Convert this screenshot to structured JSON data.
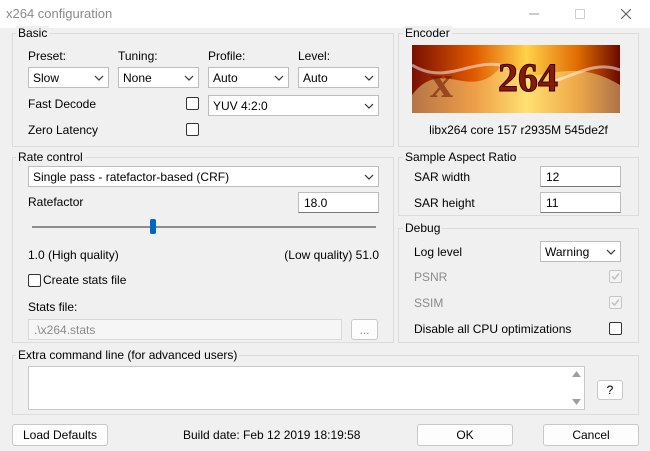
{
  "window": {
    "title": "x264 configuration"
  },
  "basic": {
    "legend": "Basic",
    "preset_label": "Preset:",
    "preset_value": "Slow",
    "tuning_label": "Tuning:",
    "tuning_value": "None",
    "profile_label": "Profile:",
    "profile_value": "Auto",
    "level_label": "Level:",
    "level_value": "Auto",
    "fast_decode_label": "Fast Decode",
    "zero_latency_label": "Zero Latency",
    "colorspace_value": "YUV 4:2:0"
  },
  "encoder": {
    "legend": "Encoder",
    "logo_text": "264",
    "version": "libx264 core 157 r2935M 545de2f"
  },
  "rate": {
    "legend": "Rate control",
    "mode_value": "Single pass - ratefactor-based (CRF)",
    "ratefactor_label": "Ratefactor",
    "ratefactor_value": "18.0",
    "slider_fraction": 0.35,
    "min_label": "1.0 (High quality)",
    "max_label": "(Low quality) 51.0",
    "create_stats_label": "Create stats file",
    "stats_file_label": "Stats file:",
    "stats_file_value": ".\\x264.stats",
    "browse_label": "..."
  },
  "sar": {
    "legend": "Sample Aspect Ratio",
    "width_label": "SAR width",
    "width_value": "12",
    "height_label": "SAR height",
    "height_value": "11"
  },
  "debug": {
    "legend": "Debug",
    "log_level_label": "Log level",
    "log_level_value": "Warning",
    "psnr_label": "PSNR",
    "ssim_label": "SSIM",
    "disable_cpu_label": "Disable all CPU optimizations"
  },
  "extra": {
    "legend": "Extra command line (for advanced users)",
    "help_label": "?"
  },
  "footer": {
    "load_defaults_label": "Load Defaults",
    "build_date": "Build date: Feb 12 2019 18:19:58",
    "ok_label": "OK",
    "cancel_label": "Cancel"
  }
}
